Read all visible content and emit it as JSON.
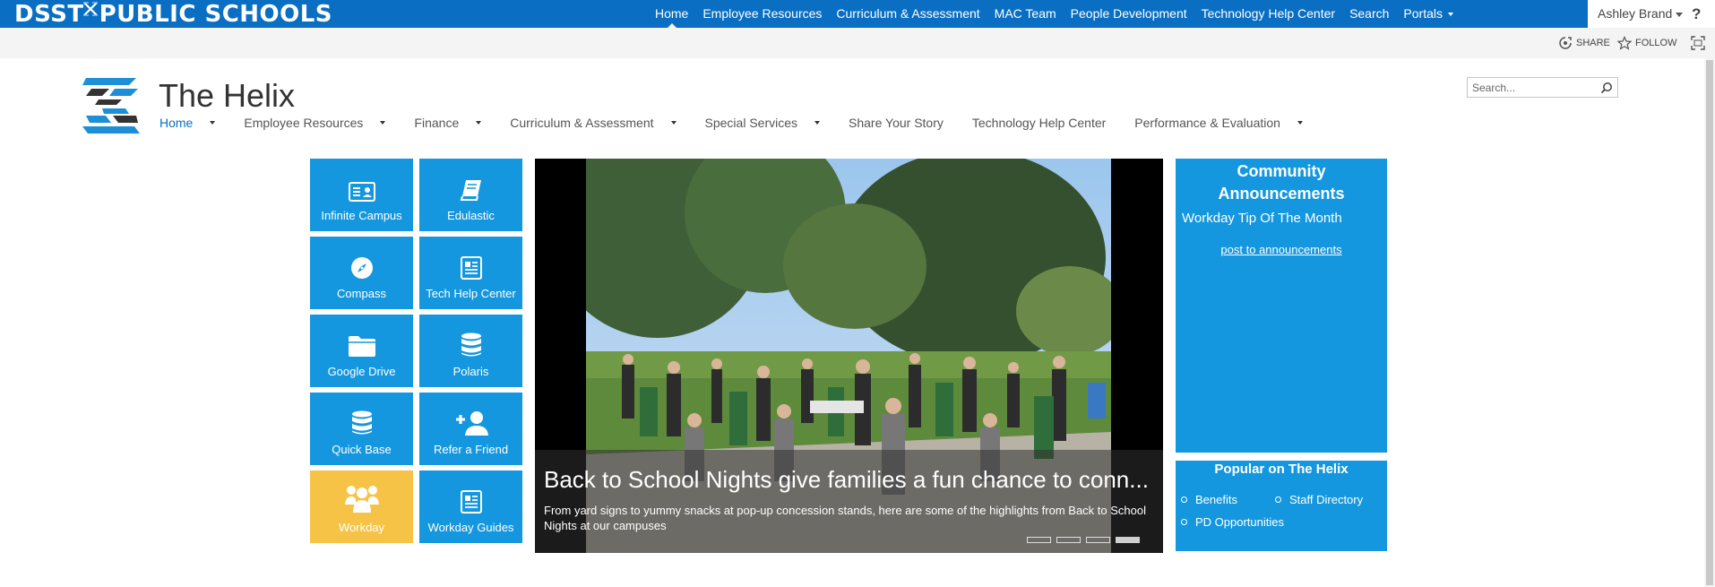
{
  "suite_bar": {
    "brand_left": "DSST",
    "brand_right": "PUBLIC SCHOOLS",
    "links": [
      "Home",
      "Employee Resources",
      "Curriculum & Assessment",
      "MAC Team",
      "People Development",
      "Technology Help Center",
      "Search",
      "Portals"
    ],
    "user": "Ashley Brand",
    "help": "?",
    "accent": "#0a6fc2"
  },
  "ribbon": {
    "share": "SHARE",
    "follow": "FOLLOW"
  },
  "site": {
    "title": "The Helix",
    "search_placeholder": "Search..."
  },
  "topnav": [
    {
      "label": "Home",
      "dropdown": true,
      "active": true
    },
    {
      "label": "Employee Resources",
      "dropdown": true
    },
    {
      "label": "Finance",
      "dropdown": true
    },
    {
      "label": "Curriculum & Assessment",
      "dropdown": true
    },
    {
      "label": "Special Services",
      "dropdown": true
    },
    {
      "label": "Share Your Story",
      "dropdown": false
    },
    {
      "label": "Technology Help Center",
      "dropdown": false
    },
    {
      "label": "Performance & Evaluation",
      "dropdown": true
    }
  ],
  "tiles": [
    {
      "label": "Infinite Campus",
      "icon": "id-card-icon"
    },
    {
      "label": "Edulastic",
      "icon": "book-icon"
    },
    {
      "label": "Compass",
      "icon": "compass-icon"
    },
    {
      "label": "Tech Help Center",
      "icon": "newspaper-icon"
    },
    {
      "label": "Google Drive",
      "icon": "folder-icon"
    },
    {
      "label": "Polaris",
      "icon": "database-icon"
    },
    {
      "label": "Quick Base",
      "icon": "database-icon"
    },
    {
      "label": "Refer a Friend",
      "icon": "add-user-icon"
    },
    {
      "label": "Workday",
      "icon": "users-icon"
    },
    {
      "label": "Workday Guides",
      "icon": "newspaper-icon"
    }
  ],
  "tile_colors": {
    "default": "#1497de",
    "highlight": "#f6c347"
  },
  "carousel": {
    "title": "Back to School Nights give families a fun chance to conn...",
    "description": "From yard signs to yummy snacks at pop-up concession stands, here are some of the highlights from Back to School Nights at our campuses",
    "slide_count": 4,
    "active_slide": 4
  },
  "announcements": {
    "title": "Community Announcements",
    "item": "Workday Tip Of The Month",
    "link": "post to announcements"
  },
  "popular": {
    "title": "Popular on The Helix",
    "links": [
      "Benefits",
      "Staff Directory",
      "PD Opportunities"
    ]
  }
}
